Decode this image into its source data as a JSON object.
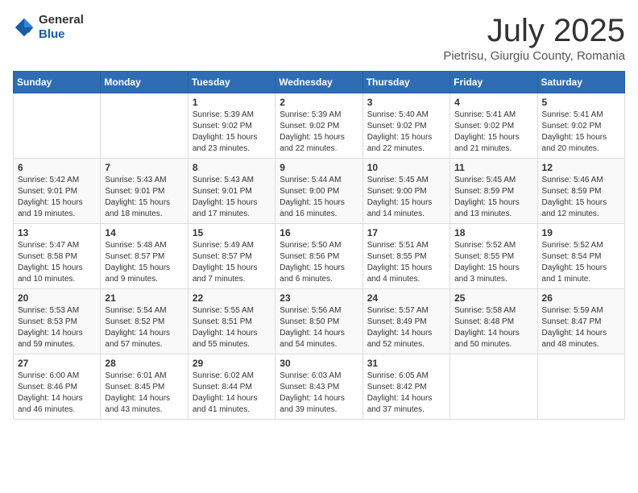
{
  "header": {
    "logo": {
      "general": "General",
      "blue": "Blue"
    },
    "title": "July 2025",
    "location": "Pietrisu, Giurgiu County, Romania"
  },
  "calendar": {
    "days_of_week": [
      "Sunday",
      "Monday",
      "Tuesday",
      "Wednesday",
      "Thursday",
      "Friday",
      "Saturday"
    ],
    "weeks": [
      [
        {
          "day": "",
          "info": ""
        },
        {
          "day": "",
          "info": ""
        },
        {
          "day": "1",
          "info": "Sunrise: 5:39 AM\nSunset: 9:02 PM\nDaylight: 15 hours and 23 minutes."
        },
        {
          "day": "2",
          "info": "Sunrise: 5:39 AM\nSunset: 9:02 PM\nDaylight: 15 hours and 22 minutes."
        },
        {
          "day": "3",
          "info": "Sunrise: 5:40 AM\nSunset: 9:02 PM\nDaylight: 15 hours and 22 minutes."
        },
        {
          "day": "4",
          "info": "Sunrise: 5:41 AM\nSunset: 9:02 PM\nDaylight: 15 hours and 21 minutes."
        },
        {
          "day": "5",
          "info": "Sunrise: 5:41 AM\nSunset: 9:02 PM\nDaylight: 15 hours and 20 minutes."
        }
      ],
      [
        {
          "day": "6",
          "info": "Sunrise: 5:42 AM\nSunset: 9:01 PM\nDaylight: 15 hours and 19 minutes."
        },
        {
          "day": "7",
          "info": "Sunrise: 5:43 AM\nSunset: 9:01 PM\nDaylight: 15 hours and 18 minutes."
        },
        {
          "day": "8",
          "info": "Sunrise: 5:43 AM\nSunset: 9:01 PM\nDaylight: 15 hours and 17 minutes."
        },
        {
          "day": "9",
          "info": "Sunrise: 5:44 AM\nSunset: 9:00 PM\nDaylight: 15 hours and 16 minutes."
        },
        {
          "day": "10",
          "info": "Sunrise: 5:45 AM\nSunset: 9:00 PM\nDaylight: 15 hours and 14 minutes."
        },
        {
          "day": "11",
          "info": "Sunrise: 5:45 AM\nSunset: 8:59 PM\nDaylight: 15 hours and 13 minutes."
        },
        {
          "day": "12",
          "info": "Sunrise: 5:46 AM\nSunset: 8:59 PM\nDaylight: 15 hours and 12 minutes."
        }
      ],
      [
        {
          "day": "13",
          "info": "Sunrise: 5:47 AM\nSunset: 8:58 PM\nDaylight: 15 hours and 10 minutes."
        },
        {
          "day": "14",
          "info": "Sunrise: 5:48 AM\nSunset: 8:57 PM\nDaylight: 15 hours and 9 minutes."
        },
        {
          "day": "15",
          "info": "Sunrise: 5:49 AM\nSunset: 8:57 PM\nDaylight: 15 hours and 7 minutes."
        },
        {
          "day": "16",
          "info": "Sunrise: 5:50 AM\nSunset: 8:56 PM\nDaylight: 15 hours and 6 minutes."
        },
        {
          "day": "17",
          "info": "Sunrise: 5:51 AM\nSunset: 8:55 PM\nDaylight: 15 hours and 4 minutes."
        },
        {
          "day": "18",
          "info": "Sunrise: 5:52 AM\nSunset: 8:55 PM\nDaylight: 15 hours and 3 minutes."
        },
        {
          "day": "19",
          "info": "Sunrise: 5:52 AM\nSunset: 8:54 PM\nDaylight: 15 hours and 1 minute."
        }
      ],
      [
        {
          "day": "20",
          "info": "Sunrise: 5:53 AM\nSunset: 8:53 PM\nDaylight: 14 hours and 59 minutes."
        },
        {
          "day": "21",
          "info": "Sunrise: 5:54 AM\nSunset: 8:52 PM\nDaylight: 14 hours and 57 minutes."
        },
        {
          "day": "22",
          "info": "Sunrise: 5:55 AM\nSunset: 8:51 PM\nDaylight: 14 hours and 55 minutes."
        },
        {
          "day": "23",
          "info": "Sunrise: 5:56 AM\nSunset: 8:50 PM\nDaylight: 14 hours and 54 minutes."
        },
        {
          "day": "24",
          "info": "Sunrise: 5:57 AM\nSunset: 8:49 PM\nDaylight: 14 hours and 52 minutes."
        },
        {
          "day": "25",
          "info": "Sunrise: 5:58 AM\nSunset: 8:48 PM\nDaylight: 14 hours and 50 minutes."
        },
        {
          "day": "26",
          "info": "Sunrise: 5:59 AM\nSunset: 8:47 PM\nDaylight: 14 hours and 48 minutes."
        }
      ],
      [
        {
          "day": "27",
          "info": "Sunrise: 6:00 AM\nSunset: 8:46 PM\nDaylight: 14 hours and 46 minutes."
        },
        {
          "day": "28",
          "info": "Sunrise: 6:01 AM\nSunset: 8:45 PM\nDaylight: 14 hours and 43 minutes."
        },
        {
          "day": "29",
          "info": "Sunrise: 6:02 AM\nSunset: 8:44 PM\nDaylight: 14 hours and 41 minutes."
        },
        {
          "day": "30",
          "info": "Sunrise: 6:03 AM\nSunset: 8:43 PM\nDaylight: 14 hours and 39 minutes."
        },
        {
          "day": "31",
          "info": "Sunrise: 6:05 AM\nSunset: 8:42 PM\nDaylight: 14 hours and 37 minutes."
        },
        {
          "day": "",
          "info": ""
        },
        {
          "day": "",
          "info": ""
        }
      ]
    ]
  }
}
